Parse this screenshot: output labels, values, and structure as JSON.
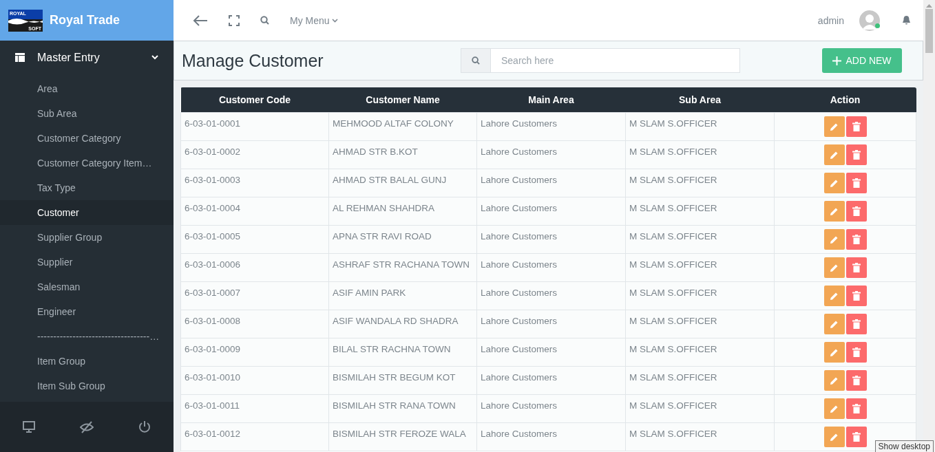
{
  "brand": {
    "logo_top": "ROYAL",
    "logo_bottom": "SOFT",
    "title": "Royal Trade"
  },
  "sidebar": {
    "section": {
      "label": "Master Entry",
      "expanded": true
    },
    "items": [
      {
        "label": "Area",
        "selected": false
      },
      {
        "label": "Sub Area",
        "selected": false
      },
      {
        "label": "Customer Category",
        "selected": false
      },
      {
        "label": "Customer Category Item…",
        "selected": false
      },
      {
        "label": "Tax Type",
        "selected": false
      },
      {
        "label": "Customer",
        "selected": true
      },
      {
        "label": "Supplier Group",
        "selected": false
      },
      {
        "label": "Supplier",
        "selected": false
      },
      {
        "label": "Salesman",
        "selected": false
      },
      {
        "label": "Engineer",
        "selected": false
      },
      {
        "label": "-----------------------------------…",
        "selected": false
      },
      {
        "label": "Item Group",
        "selected": false
      },
      {
        "label": "Item Sub Group",
        "selected": false
      }
    ]
  },
  "topbar": {
    "menu": "My Menu",
    "user": "admin",
    "online": true
  },
  "page": {
    "title": "Manage Customer",
    "search": {
      "placeholder": "Search here"
    },
    "add_button": "ADD NEW"
  },
  "table": {
    "columns": [
      "Customer Code",
      "Customer Name",
      "Main Area",
      "Sub Area",
      "Action"
    ],
    "rows": [
      [
        "6-03-01-0001",
        "MEHMOOD ALTAF COLONY",
        "Lahore Customers",
        "M SLAM S.OFFICER"
      ],
      [
        "6-03-01-0002",
        "AHMAD STR B.KOT",
        "Lahore Customers",
        "M SLAM S.OFFICER"
      ],
      [
        "6-03-01-0003",
        "AHMAD STR BALAL GUNJ",
        "Lahore Customers",
        "M SLAM S.OFFICER"
      ],
      [
        "6-03-01-0004",
        "AL REHMAN SHAHDRA",
        "Lahore Customers",
        "M SLAM S.OFFICER"
      ],
      [
        "6-03-01-0005",
        "APNA STR RAVI ROAD",
        "Lahore Customers",
        "M SLAM S.OFFICER"
      ],
      [
        "6-03-01-0006",
        "ASHRAF STR RACHANA TOWN",
        "Lahore Customers",
        "M SLAM S.OFFICER"
      ],
      [
        "6-03-01-0007",
        "ASIF AMIN PARK",
        "Lahore Customers",
        "M SLAM S.OFFICER"
      ],
      [
        "6-03-01-0008",
        "ASIF WANDALA RD SHADRA",
        "Lahore Customers",
        "M SLAM S.OFFICER"
      ],
      [
        "6-03-01-0009",
        "BILAL STR RACHNA TOWN",
        "Lahore Customers",
        "M SLAM S.OFFICER"
      ],
      [
        "6-03-01-0010",
        "BISMILAH STR BEGUM KOT",
        "Lahore Customers",
        "M SLAM S.OFFICER"
      ],
      [
        "6-03-01-0011",
        "BISMILAH STR RANA TOWN",
        "Lahore Customers",
        "M SLAM S.OFFICER"
      ],
      [
        "6-03-01-0012",
        "BISMILAH STR FEROZE WALA",
        "Lahore Customers",
        "M SLAM S.OFFICER"
      ]
    ]
  },
  "tooltip": "Show desktop"
}
